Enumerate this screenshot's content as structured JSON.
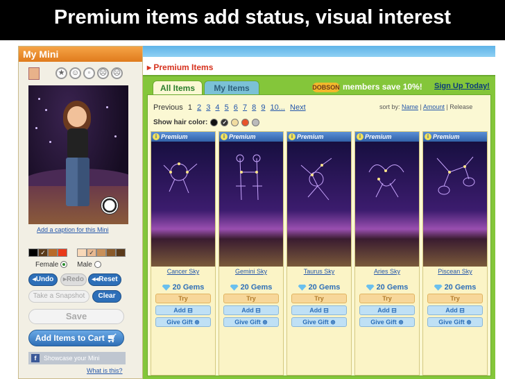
{
  "slide_title": "Premium items add status, visual interest",
  "left_panel": {
    "header": "My Mini",
    "caption_link": "Add a caption for this Mini",
    "gender": {
      "female": "Female",
      "male": "Male",
      "selected": "female"
    },
    "buttons": {
      "undo": "Undo",
      "redo": "Redo",
      "reset": "Reset",
      "snapshot": "Take a Snapshot",
      "clear": "Clear",
      "save": "Save",
      "add_to_cart": "Add Items to Cart"
    },
    "showcase": "Showcase your Mini",
    "what_is_this": "What is this?"
  },
  "right_panel": {
    "section_title": "Premium Items",
    "tabs": [
      {
        "label": "All Items",
        "active": true
      },
      {
        "label": "My Items",
        "active": false
      }
    ],
    "promo_logo": "DOBSON",
    "promo_text": "members save 10%!",
    "signup_link": "Sign Up Today!",
    "pager": {
      "previous": "Previous",
      "current": "1",
      "pages": [
        "2",
        "3",
        "4",
        "5",
        "6",
        "7",
        "8",
        "9",
        "10..."
      ],
      "next": "Next"
    },
    "sort": {
      "label": "sort by:",
      "name": "Name",
      "amount": "Amount",
      "release": "Release"
    },
    "hair_color_label": "Show hair color:",
    "hair_colors": [
      "#111111",
      "#333333",
      "#f1dca0",
      "#e8532a",
      "#bbbbbb"
    ],
    "items": [
      {
        "badge": "Premium",
        "name": "Cancer Sky",
        "price": "20 Gems",
        "try": "Try",
        "add": "Add",
        "gift": "Give Gift"
      },
      {
        "badge": "Premium",
        "name": "Gemini Sky",
        "price": "20 Gems",
        "try": "Try",
        "add": "Add",
        "gift": "Give Gift"
      },
      {
        "badge": "Premium",
        "name": "Taurus Sky",
        "price": "20 Gems",
        "try": "Try",
        "add": "Add",
        "gift": "Give Gift"
      },
      {
        "badge": "Premium",
        "name": "Aries Sky",
        "price": "20 Gems",
        "try": "Try",
        "add": "Add",
        "gift": "Give Gift"
      },
      {
        "badge": "Premium",
        "name": "Piscean Sky",
        "price": "20 Gems",
        "try": "Try",
        "add": "Add",
        "gift": "Give Gift"
      }
    ]
  },
  "colors": {
    "accent": "#d6321e",
    "link": "#2255aa",
    "button_blue": "#2d6fb8",
    "background_green": "#84c63a"
  },
  "icons": [
    "star-face-icon",
    "smile-face-icon",
    "neutral-face-icon",
    "frown-face-icon",
    "sad-face-icon",
    "gem-icon",
    "cart-icon",
    "gift-icon",
    "facebook-icon",
    "info-icon"
  ]
}
